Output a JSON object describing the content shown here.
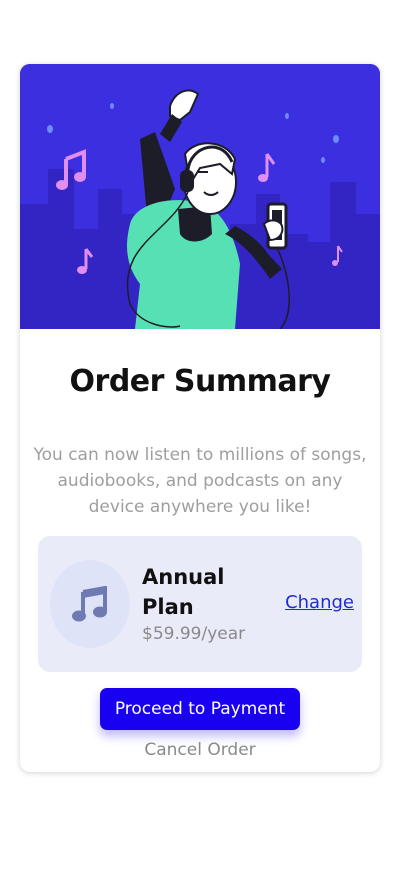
{
  "card": {
    "title": "Order Summary",
    "description": "You can now listen to millions of songs, audiobooks, and podcasts on any device anywhere you like!"
  },
  "plan": {
    "name": "Annual Plan",
    "price": "$59.99/year",
    "change_label": "Change",
    "icon": "music-note-icon"
  },
  "actions": {
    "proceed_label": "Proceed to Payment",
    "cancel_label": "Cancel Order"
  },
  "colors": {
    "hero_background": "#3b2fe0",
    "accent": "#1a00f0",
    "plan_background": "#e9ebf9",
    "link": "#1f2bd6"
  }
}
